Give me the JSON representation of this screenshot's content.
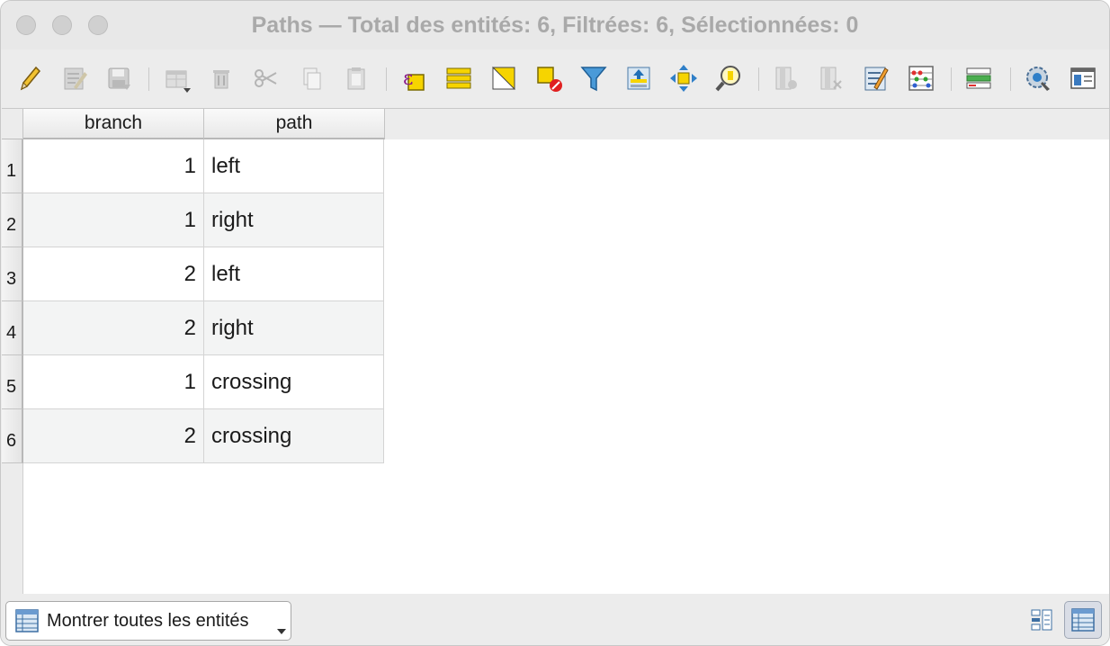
{
  "window": {
    "title": "Paths — Total des entités: 6, Filtrées: 6, Sélectionnées: 0"
  },
  "toolbar": {
    "icons": [
      "toggle-editing-icon",
      "multi-edit-icon",
      "save-edits-icon",
      "add-feature-icon",
      "delete-feature-icon",
      "cut-icon",
      "copy-icon",
      "paste-icon",
      "select-by-expression-icon",
      "select-all-icon",
      "invert-selection-icon",
      "deselect-all-icon",
      "filter-icon",
      "move-selection-to-top-icon",
      "pan-to-selected-icon",
      "zoom-to-selected-icon",
      "new-field-icon",
      "delete-field-icon",
      "field-calculator-icon",
      "conditional-formatting-icon",
      "organize-columns-icon",
      "actions-icon",
      "dock-table-icon"
    ]
  },
  "table": {
    "columns": [
      "branch",
      "path"
    ],
    "rows": [
      {
        "id": "1",
        "branch": "1",
        "path": "left"
      },
      {
        "id": "2",
        "branch": "1",
        "path": "right"
      },
      {
        "id": "3",
        "branch": "2",
        "path": "left"
      },
      {
        "id": "4",
        "branch": "2",
        "path": "right"
      },
      {
        "id": "5",
        "branch": "1",
        "path": "crossing"
      },
      {
        "id": "6",
        "branch": "2",
        "path": "crossing"
      }
    ]
  },
  "bottom": {
    "filter_label": "Montrer toutes les entités",
    "active_view": "table"
  }
}
